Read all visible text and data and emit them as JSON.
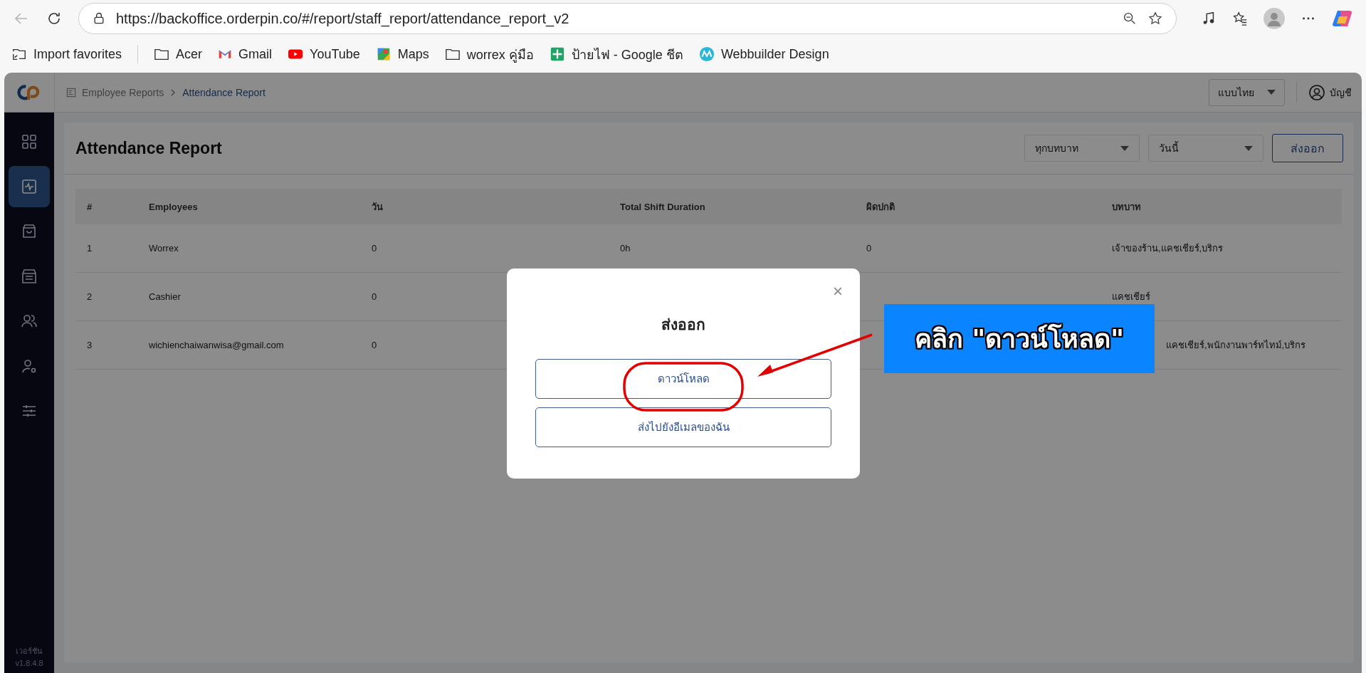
{
  "browser": {
    "url": "https://backoffice.orderpin.co/#/report/staff_report/attendance_report_v2",
    "bookmarks": [
      {
        "kind": "import",
        "label": "Import favorites"
      },
      {
        "kind": "folder",
        "label": "Acer"
      },
      {
        "kind": "gmail",
        "label": "Gmail"
      },
      {
        "kind": "youtube",
        "label": "YouTube"
      },
      {
        "kind": "maps",
        "label": "Maps"
      },
      {
        "kind": "folder",
        "label": "worrex คู่มือ"
      },
      {
        "kind": "sheets",
        "label": "ป้ายไฟ - Google ชีต"
      },
      {
        "kind": "webbuilder",
        "label": "Webbuilder Design"
      }
    ]
  },
  "sidebar": {
    "items": [
      {
        "kind": "grid",
        "selected": false
      },
      {
        "kind": "pulse",
        "selected": true
      },
      {
        "kind": "bag",
        "selected": false
      },
      {
        "kind": "archive",
        "selected": false
      },
      {
        "kind": "users",
        "selected": false
      },
      {
        "kind": "user-gear",
        "selected": false
      },
      {
        "kind": "sliders",
        "selected": false
      }
    ],
    "version_label": "เวอร์ชัน",
    "version": "v1.8.4.8"
  },
  "header": {
    "breadcrumbs": [
      "Employee Reports",
      "Attendance Report"
    ],
    "language": "แบบไทย",
    "account": "บัญชี"
  },
  "page": {
    "title": "Attendance Report",
    "role_filter": "ทุกบทบาท",
    "date_filter": "วันนี้",
    "export_button": "ส่งออก"
  },
  "table": {
    "columns": [
      "#",
      "Employees",
      "วัน",
      "Total Shift Duration",
      "ผิดปกติ",
      "บทบาท"
    ],
    "rows": [
      {
        "cells": [
          "1",
          "Worrex",
          "0",
          "0h",
          "0",
          "เจ้าของร้าน,แคชเชียร์,บริกร"
        ],
        "role_cut": false
      },
      {
        "cells": [
          "2",
          "Cashier",
          "0",
          "",
          "",
          "แคชเชียร์"
        ],
        "role_cut": false
      },
      {
        "cells": [
          "3",
          "wichienchaiwanwisa@gmail.com",
          "0",
          "",
          "",
          "แคชเชียร์,พนักงานพาร์ทไทม์,บริกร"
        ],
        "role_cut": true
      }
    ]
  },
  "modal": {
    "title": "ส่งออก",
    "close": "×",
    "buttons": [
      "ดาวน์โหลด",
      "ส่งไปยังอีเมลของฉัน"
    ]
  },
  "annotation": {
    "text": "คลิก \"ดาวน์โหลด\""
  }
}
